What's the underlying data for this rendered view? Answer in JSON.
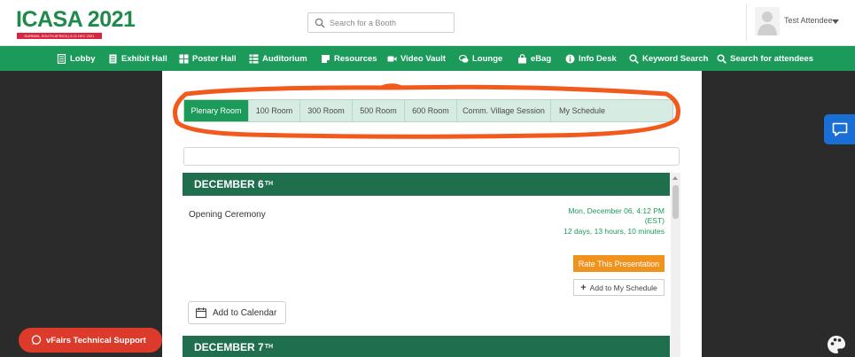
{
  "header": {
    "logo_title": "ICASA 2021",
    "logo_subtitle": "DURBAN, SOUTH AFRICA | 6-11 DEC 2021",
    "search_placeholder": "Search for a Booth",
    "user_name": "Test Attendee"
  },
  "nav": {
    "items": [
      {
        "label": "Lobby",
        "icon": "lobby-icon"
      },
      {
        "label": "Exhibit Hall",
        "icon": "exhibit-hall-icon"
      },
      {
        "label": "Poster Hall",
        "icon": "poster-hall-icon"
      },
      {
        "label": "Auditorium",
        "icon": "auditorium-icon"
      },
      {
        "label": "Resources",
        "icon": "resources-icon"
      },
      {
        "label": "Video Vault",
        "icon": "video-camera-icon"
      },
      {
        "label": "Lounge",
        "icon": "chat-bubbles-icon"
      },
      {
        "label": "eBag",
        "icon": "shopping-bag-icon"
      },
      {
        "label": "Info Desk",
        "icon": "info-icon"
      },
      {
        "label": "Keyword Search",
        "icon": "search-icon"
      },
      {
        "label": "Search for attendees",
        "icon": "search-icon"
      }
    ]
  },
  "tabs": [
    {
      "label": "Plenary Room",
      "active": true
    },
    {
      "label": "100 Room",
      "active": false
    },
    {
      "label": "300 Room",
      "active": false
    },
    {
      "label": "500 Room",
      "active": false
    },
    {
      "label": "600 Room",
      "active": false
    },
    {
      "label": "Comm. Village Session",
      "active": false
    },
    {
      "label": "My Schedule",
      "active": false
    }
  ],
  "schedule": {
    "day1": {
      "title": "DECEMBER 6",
      "suffix": "TH"
    },
    "day2": {
      "title": "DECEMBER 7",
      "suffix": "TH"
    },
    "session": {
      "title": "Opening Ceremony",
      "date": "Mon, December 06, 4:12 PM",
      "timezone": "(EST)",
      "countdown": "12 days, 13 hours, 10 minutes",
      "rate_label": "Rate This Presentation",
      "add_schedule_label": "Add to My Schedule",
      "add_calendar_label": "Add to Calendar"
    }
  },
  "support": {
    "label": "vFairs Technical Support"
  },
  "colors": {
    "brand_green": "#1b9a5a",
    "day_header": "#1f6f4e",
    "rate_button": "#f0921e",
    "support_button": "#dc3b2b",
    "chat_button": "#1a6fd6",
    "annotation": "#f2591c"
  }
}
